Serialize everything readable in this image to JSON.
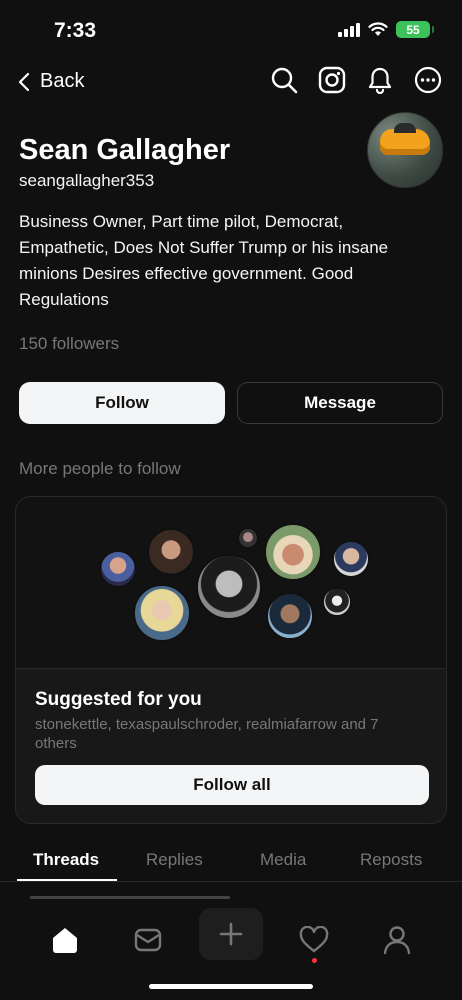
{
  "status": {
    "time": "7:33",
    "battery": "55",
    "icons": [
      "signal-icon",
      "wifi-icon",
      "battery-icon"
    ]
  },
  "nav": {
    "back_label": "Back",
    "icons": [
      "search-icon",
      "instagram-icon",
      "bell-icon",
      "more-icon"
    ]
  },
  "profile": {
    "name": "Sean Gallagher",
    "handle": "seangallagher353",
    "bio": "Business Owner, Part time pilot, Democrat, Empathetic, Does Not Suffer Trump or his insane minions Desires effective government. Good Regulations",
    "followers": "150 followers"
  },
  "actions": {
    "follow_label": "Follow",
    "message_label": "Message"
  },
  "suggestions": {
    "heading": "More people to follow",
    "title": "Suggested for you",
    "names": "stonekettle, texaspaulschroder, realmiafarrow and 7 others",
    "follow_all_label": "Follow all"
  },
  "tabs": [
    "Threads",
    "Replies",
    "Media",
    "Reposts"
  ],
  "active_tab": "Threads",
  "bottom_nav": [
    "home-icon",
    "inbox-icon",
    "compose-icon",
    "heart-icon",
    "profile-icon"
  ],
  "colors": {
    "background": "#101010",
    "muted_text": "#777777",
    "primary_button": "#f3f5f7",
    "battery": "#3cc25a",
    "notification_dot": "#ff3040"
  }
}
